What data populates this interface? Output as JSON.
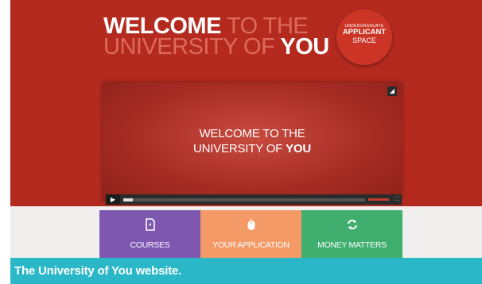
{
  "hero": {
    "headline_part1": "WELCOME",
    "headline_part2": " TO THE",
    "headline_part3": "UNIVERSITY OF",
    "headline_part4": " YOU"
  },
  "badge": {
    "line1": "UNDERGRADUATE",
    "line2": "APPLICANT",
    "line3": "SPACE"
  },
  "video": {
    "title_line1": "WELCOME TO THE",
    "title_line2": "UNIVERSITY OF",
    "title_bold": "YOU",
    "progress_fraction": 0.04
  },
  "tiles": [
    {
      "label": "COURSES",
      "icon": "document-icon",
      "color": "#7e58b0"
    },
    {
      "label": "YOUR APPLICATION",
      "icon": "mouse-icon",
      "color": "#f39a67"
    },
    {
      "label": "MONEY MATTERS",
      "icon": "refresh-icon",
      "color": "#3fae6e"
    }
  ],
  "caption": {
    "text": "The University of You website."
  },
  "colors": {
    "hero_red": "#b42a1f",
    "caption_teal": "#2ab8c8"
  }
}
